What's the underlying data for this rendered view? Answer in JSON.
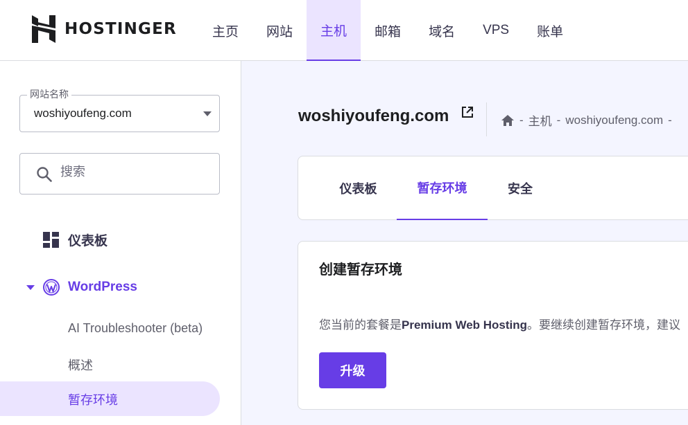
{
  "brand": {
    "name": "HOSTINGER"
  },
  "nav": {
    "items": [
      {
        "label": "主页"
      },
      {
        "label": "网站"
      },
      {
        "label": "主机",
        "active": true
      },
      {
        "label": "邮箱"
      },
      {
        "label": "域名"
      },
      {
        "label": "VPS"
      },
      {
        "label": "账单"
      }
    ]
  },
  "sidebar": {
    "site_select": {
      "label": "网站名称",
      "value": "woshiyoufeng.com"
    },
    "search": {
      "placeholder": "搜索"
    },
    "dashboard_label": "仪表板",
    "wordpress_label": "WordPress",
    "sub_items": [
      {
        "label": "AI Troubleshooter (beta)"
      },
      {
        "label": "概述"
      },
      {
        "label": "暂存环境",
        "active": true
      }
    ]
  },
  "main": {
    "title": "woshiyoufeng.com",
    "breadcrumb": {
      "sep": "-",
      "hosting": "主机",
      "site": "woshiyoufeng.com"
    },
    "tabs": [
      {
        "label": "仪表板"
      },
      {
        "label": "暂存环境",
        "active": true
      },
      {
        "label": "安全"
      }
    ],
    "card": {
      "title": "创建暂存环境",
      "text_prefix": "您当前的套餐是",
      "plan": "Premium Web Hosting",
      "text_suffix": "。要继续创建暂存环境，建议",
      "button": "升级"
    }
  },
  "colors": {
    "accent": "#673de6",
    "accent_light": "#ebe4ff",
    "text": "#1d1e20",
    "muted": "#5f5f6b"
  },
  "icons": [
    "hostinger-logo-icon",
    "caret-down-icon",
    "search-icon",
    "dashboard-icon",
    "wordpress-icon",
    "external-link-icon",
    "home-icon"
  ]
}
